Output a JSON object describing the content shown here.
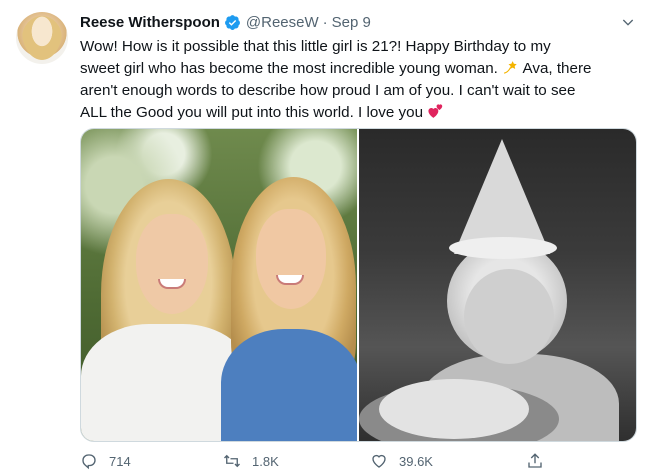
{
  "author": {
    "name": "Reese Witherspoon",
    "handle": "@ReeseW",
    "separator": "·",
    "date": "Sep 9",
    "verified": true
  },
  "tweet": {
    "lines": [
      "Wow! How is it possible that this little girl is 21?! Happy Birthday to my",
      "sweet girl who has become the most incredible young woman.",
      "Ava, there",
      "aren't enough words to describe how proud I am of you. I can't wait to see",
      "ALL the Good you will put into this world. I love you"
    ],
    "emojis": [
      "dizzy-star-emoji",
      "two-hearts-emoji"
    ]
  },
  "media": {
    "left_photo": "two-women-smiling-photo",
    "right_photo": "child-birthday-bw-photo"
  },
  "actions": {
    "reply_count": "714",
    "retweet_count": "1.8K",
    "like_count": "39.6K",
    "share_icon": "share-icon"
  },
  "colors": {
    "text": "#0f1419",
    "muted": "#536471",
    "verified_blue": "#1d9bf0"
  }
}
